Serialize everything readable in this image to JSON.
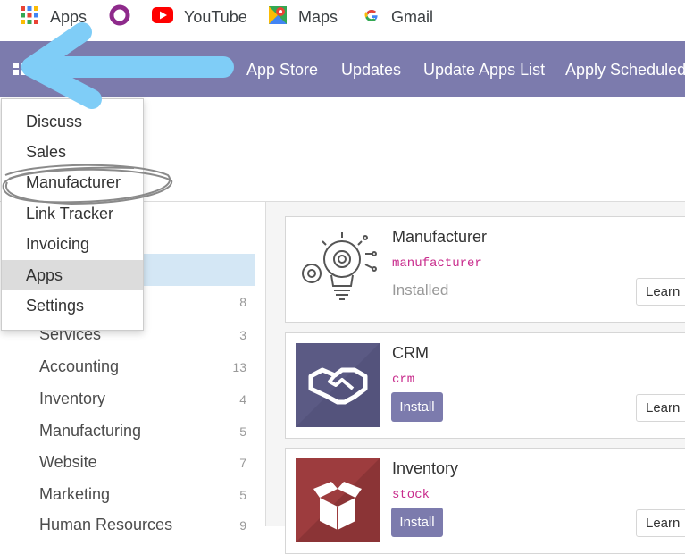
{
  "bookmarks": [
    {
      "icon": "apps-grid-icon",
      "label": "Apps"
    },
    {
      "icon": "ring-icon",
      "label": ""
    },
    {
      "icon": "youtube-icon",
      "label": "YouTube"
    },
    {
      "icon": "maps-icon",
      "label": "Maps"
    },
    {
      "icon": "google-icon",
      "label": "Gmail"
    }
  ],
  "nav": {
    "links": [
      "App Store",
      "Updates",
      "Update Apps List",
      "Apply Scheduled"
    ],
    "bg": "#7c7bad"
  },
  "menu": {
    "items": [
      "Discuss",
      "Sales",
      "Manufacturer",
      "Link Tracker",
      "Invoicing",
      "Apps",
      "Settings"
    ],
    "highlighted": "Apps",
    "circled": "Manufacturer"
  },
  "sidebar": {
    "items": [
      {
        "label": "Services",
        "count": "3"
      },
      {
        "label": "Accounting",
        "count": "13"
      },
      {
        "label": "Inventory",
        "count": "4"
      },
      {
        "label": "Manufacturing",
        "count": "5"
      },
      {
        "label": "Website",
        "count": "7"
      },
      {
        "label": "Marketing",
        "count": "5"
      },
      {
        "label": "Human Resources",
        "count": "9"
      }
    ],
    "partial_count": "8"
  },
  "cards": [
    {
      "title": "Manufacturer",
      "tech": "manufacturer",
      "status": "Installed",
      "learn": "Learn",
      "icon": "lightbulb-gear-icon"
    },
    {
      "title": "CRM",
      "tech": "crm",
      "button": "Install",
      "learn": "Learn",
      "icon": "handshake-icon"
    },
    {
      "title": "Inventory",
      "tech": "stock",
      "button": "Install",
      "learn": "Learn",
      "icon": "box-icon"
    }
  ],
  "annotations": {
    "arrow_color": "#7fcdf7"
  }
}
